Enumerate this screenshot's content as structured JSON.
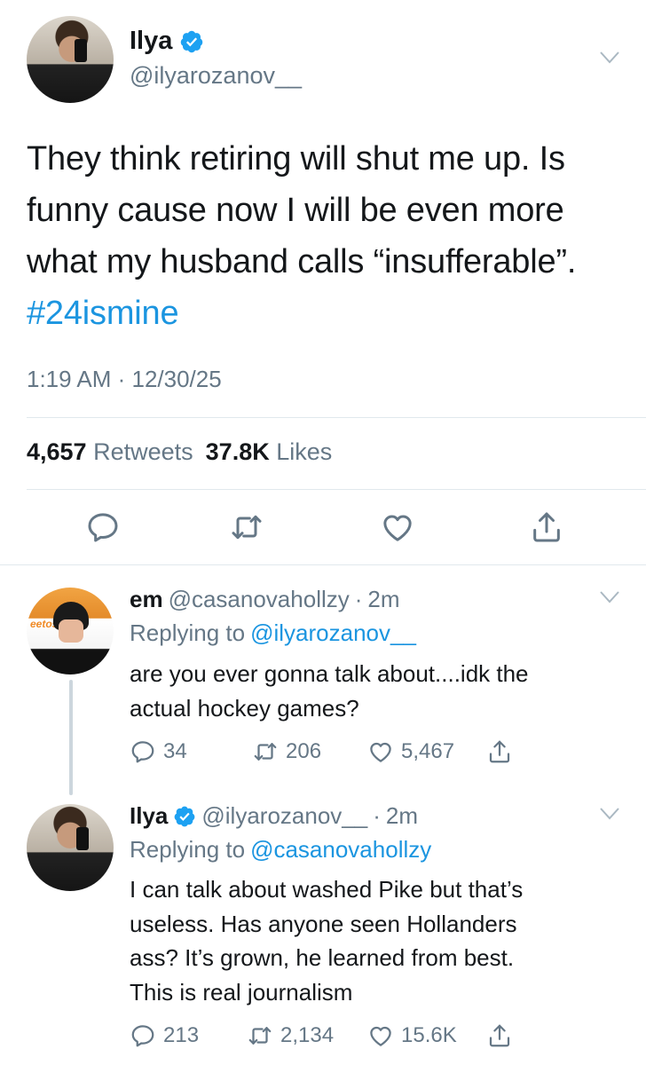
{
  "main_tweet": {
    "name": "Ilya",
    "handle": "@ilyarozanov__",
    "text_lines": [
      "They think retiring will shut me up. Is",
      "funny cause now I will be even more",
      "what my husband calls “insufferable”."
    ],
    "hashtag": "#24ismine",
    "timestamp": "1:19 AM · 12/30/25",
    "retweets_count": "4,657",
    "retweets_label": "Retweets",
    "likes_count": "37.8K",
    "likes_label": "Likes",
    "icons": [
      "reply-icon",
      "retweet-icon",
      "like-icon",
      "share-icon",
      "chevron-down-icon",
      "verified-badge-icon"
    ]
  },
  "replies": [
    {
      "name": "em",
      "handle": "@casanovahollzy",
      "dot": "·",
      "time": "2m",
      "replying_prefix": "Replying to",
      "replying_to": "@ilyarozanov__",
      "text_lines": [
        "are you ever gonna talk about....idk the",
        "actual hockey games?"
      ],
      "reply_count": "34",
      "retweet_count": "206",
      "like_count": "5,467"
    },
    {
      "name": "Ilya",
      "handle": "@ilyarozanov__",
      "dot": "·",
      "time": "2m",
      "replying_prefix": "Replying to",
      "replying_to": "@casanovahollzy",
      "text_lines": [
        "I can talk about washed Pike but that’s",
        "useless. Has anyone seen Hollanders",
        "ass? It’s grown, he learned from best.",
        "This is real journalism"
      ],
      "reply_count": "213",
      "retweet_count": "2,134",
      "like_count": "15.6K"
    }
  ],
  "colors": {
    "link_blue": "#1b95e0",
    "secondary_grey": "#657786",
    "text": "#14171a",
    "divider": "#e1e8ed",
    "verified": "#1da1f2"
  }
}
